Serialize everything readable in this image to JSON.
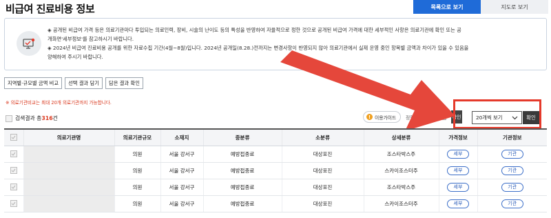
{
  "page": {
    "title": "비급여 진료비용 정보"
  },
  "view_tabs": {
    "list": "목록으로 보기",
    "map": "지도로 보기"
  },
  "notice": {
    "icon": "monitor-check-icon",
    "lines": [
      "◈ 공개된 비급여 가격 등은 의료기관마다 투입되는 의료인력, 장비, 시술의 난이도 등의 특성을 반영하여 자율적으로 정한 것으로 공개된 비급여 가격에 대한 세부적인 사항은 의료기관에 확인 또는 공",
      "개화면'세부정보'를 참고하시기 바랍니다.",
      "◈ 2024년 비급여 진료비용 공개를 위한 자료수집 기간(4월~8월)입니다. 2024년 공개일(8.28.)전까지는 변경사항이 반영되지 않아 의료기관에서 실제 운영 중인 항목별 금액과 차이가 있을 수 있음을",
      "양해하여 주시기 바랍니다."
    ]
  },
  "buttons": {
    "region_compare": "지역별·규모별 금액 비교",
    "save_selection": "선택 결과 담기",
    "view_saved": "담은 결과 확인"
  },
  "warning": "※ 의료기관비교는 최대 20개 의료기관까지 가능합니다.",
  "result": {
    "prefix": "검색결과 총",
    "count": "316",
    "suffix": "건"
  },
  "controls": {
    "guide": "이용가이드",
    "sort_label": "정렬기준 선택",
    "confirm_small": "확인",
    "page_size": "20개씩 보기",
    "confirm": "확인"
  },
  "accent": {
    "primary": "#1f6bd8",
    "highlight": "#e53a2b",
    "warning": "#d9381e"
  },
  "table": {
    "headers": [
      "의료기관명",
      "의료기관규모",
      "소재지",
      "중분류",
      "소분류",
      "상세분류",
      "가격정보",
      "기관정보"
    ],
    "rows": [
      {
        "name": "",
        "scale": "의원",
        "location": "서울 강서구",
        "mid": "예방접종료",
        "small": "대상포진",
        "detail": "조스타박스주",
        "price_btn": "세부",
        "info_btn": "기관"
      },
      {
        "name": "",
        "scale": "의원",
        "location": "서울 강서구",
        "mid": "예방접종료",
        "small": "대상포진",
        "detail": "스카이조스터주",
        "price_btn": "세부",
        "info_btn": "기관"
      },
      {
        "name": "",
        "scale": "의원",
        "location": "서울 강서구",
        "mid": "예방접종료",
        "small": "대상포진",
        "detail": "조스타박스주",
        "price_btn": "세부",
        "info_btn": "기관"
      },
      {
        "name": "",
        "scale": "의원",
        "location": "서울 강서구",
        "mid": "예방접종료",
        "small": "대상포진",
        "detail": "스카이조스터주",
        "price_btn": "세부",
        "info_btn": "기관"
      }
    ]
  }
}
